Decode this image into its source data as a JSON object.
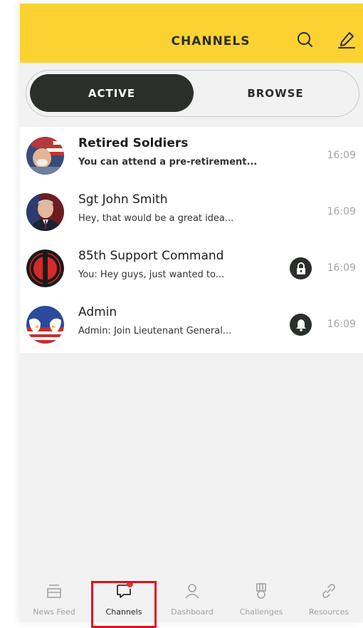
{
  "header": {
    "title": "CHANNELS"
  },
  "segment": {
    "active_label": "ACTIVE",
    "browse_label": "BROWSE",
    "selected": "ACTIVE"
  },
  "channels": [
    {
      "title": "Retired Soldiers",
      "preview": "You can attend a pre-retirement...",
      "time": "16:09",
      "unread": true,
      "badge": null,
      "avatar": "retired-soldier-photo"
    },
    {
      "title": "Sgt John Smith",
      "preview": "Hey, that would be a great idea...",
      "time": "16:09",
      "unread": false,
      "badge": null,
      "avatar": "man-in-suit-photo"
    },
    {
      "title": "85th Support Command",
      "preview": "You: Hey guys, just wanted to...",
      "time": "16:09",
      "unread": false,
      "badge": "lock-icon",
      "avatar": "red-black-insignia"
    },
    {
      "title": "Admin",
      "preview": "Admin: Join Lieutenant General...",
      "time": "16:09",
      "unread": false,
      "badge": "bell-icon",
      "avatar": "eagle-flag-logo"
    }
  ],
  "bottom_nav": {
    "items": [
      {
        "label": "News Feed",
        "icon": "news-feed-icon"
      },
      {
        "label": "Channels",
        "icon": "chat-bubble-icon",
        "active": true,
        "notification_dot": true
      },
      {
        "label": "Dashboard",
        "icon": "person-icon"
      },
      {
        "label": "Challenges",
        "icon": "medal-icon"
      },
      {
        "label": "Resources",
        "icon": "link-icon"
      }
    ]
  },
  "colors": {
    "header_bg": "#fcd232",
    "dark": "#2b2f2b",
    "page_bg": "#f2f2f2",
    "time_gray": "#a5a5a5",
    "highlight_red": "#e2101e",
    "notification_dot": "#e8303e"
  }
}
